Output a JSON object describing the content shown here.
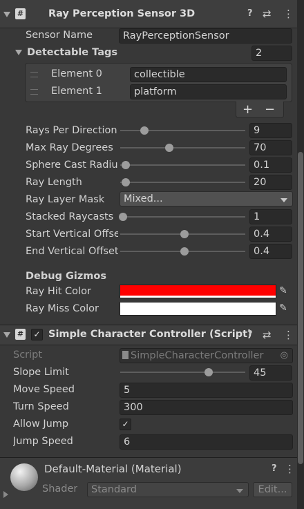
{
  "ray_sensor": {
    "title": "Ray Perception Sensor 3D",
    "sensor_name_label": "Sensor Name",
    "sensor_name_value": "RayPerceptionSensor",
    "detectable_tags_label": "Detectable Tags",
    "detectable_tags_count": "2",
    "elements": [
      {
        "label": "Element 0",
        "value": "collectible"
      },
      {
        "label": "Element 1",
        "value": "platform"
      }
    ],
    "add_label": "+",
    "remove_label": "−",
    "rays_per_direction": {
      "label": "Rays Per Direction",
      "value": "9"
    },
    "max_ray_degrees": {
      "label": "Max Ray Degrees",
      "value": "70"
    },
    "sphere_cast_radius": {
      "label": "Sphere Cast Radiu",
      "value": "0.1"
    },
    "ray_length": {
      "label": "Ray Length",
      "value": "20"
    },
    "ray_layer_mask": {
      "label": "Ray Layer Mask",
      "value": "Mixed..."
    },
    "stacked_raycasts": {
      "label": "Stacked Raycasts",
      "value": "1"
    },
    "start_vertical_offset": {
      "label": "Start Vertical Offse",
      "value": "0.4"
    },
    "end_vertical_offset": {
      "label": "End Vertical Offset",
      "value": "0.4"
    },
    "debug_gizmos_label": "Debug Gizmos",
    "ray_hit_color": {
      "label": "Ray Hit Color",
      "color": "#ff0000"
    },
    "ray_miss_color": {
      "label": "Ray Miss Color",
      "color": "#ffffff"
    }
  },
  "char_controller": {
    "title": "Simple Character Controller (Script)",
    "script_label": "Script",
    "script_value": "SimpleCharacterController",
    "slope_limit": {
      "label": "Slope Limit",
      "value": "45"
    },
    "move_speed": {
      "label": "Move Speed",
      "value": "5"
    },
    "turn_speed": {
      "label": "Turn Speed",
      "value": "300"
    },
    "allow_jump": {
      "label": "Allow Jump",
      "checked": true
    },
    "jump_speed": {
      "label": "Jump Speed",
      "value": "6"
    }
  },
  "material": {
    "title": "Default-Material (Material)",
    "shader_label": "Shader",
    "shader_value": "Standard",
    "edit_label": "Edit..."
  },
  "icons": {
    "script_glyph": "#",
    "help": "?",
    "presets": "⇄",
    "menu": "⋮",
    "check": "✓",
    "eyedropper": "✎",
    "target": "◎"
  }
}
